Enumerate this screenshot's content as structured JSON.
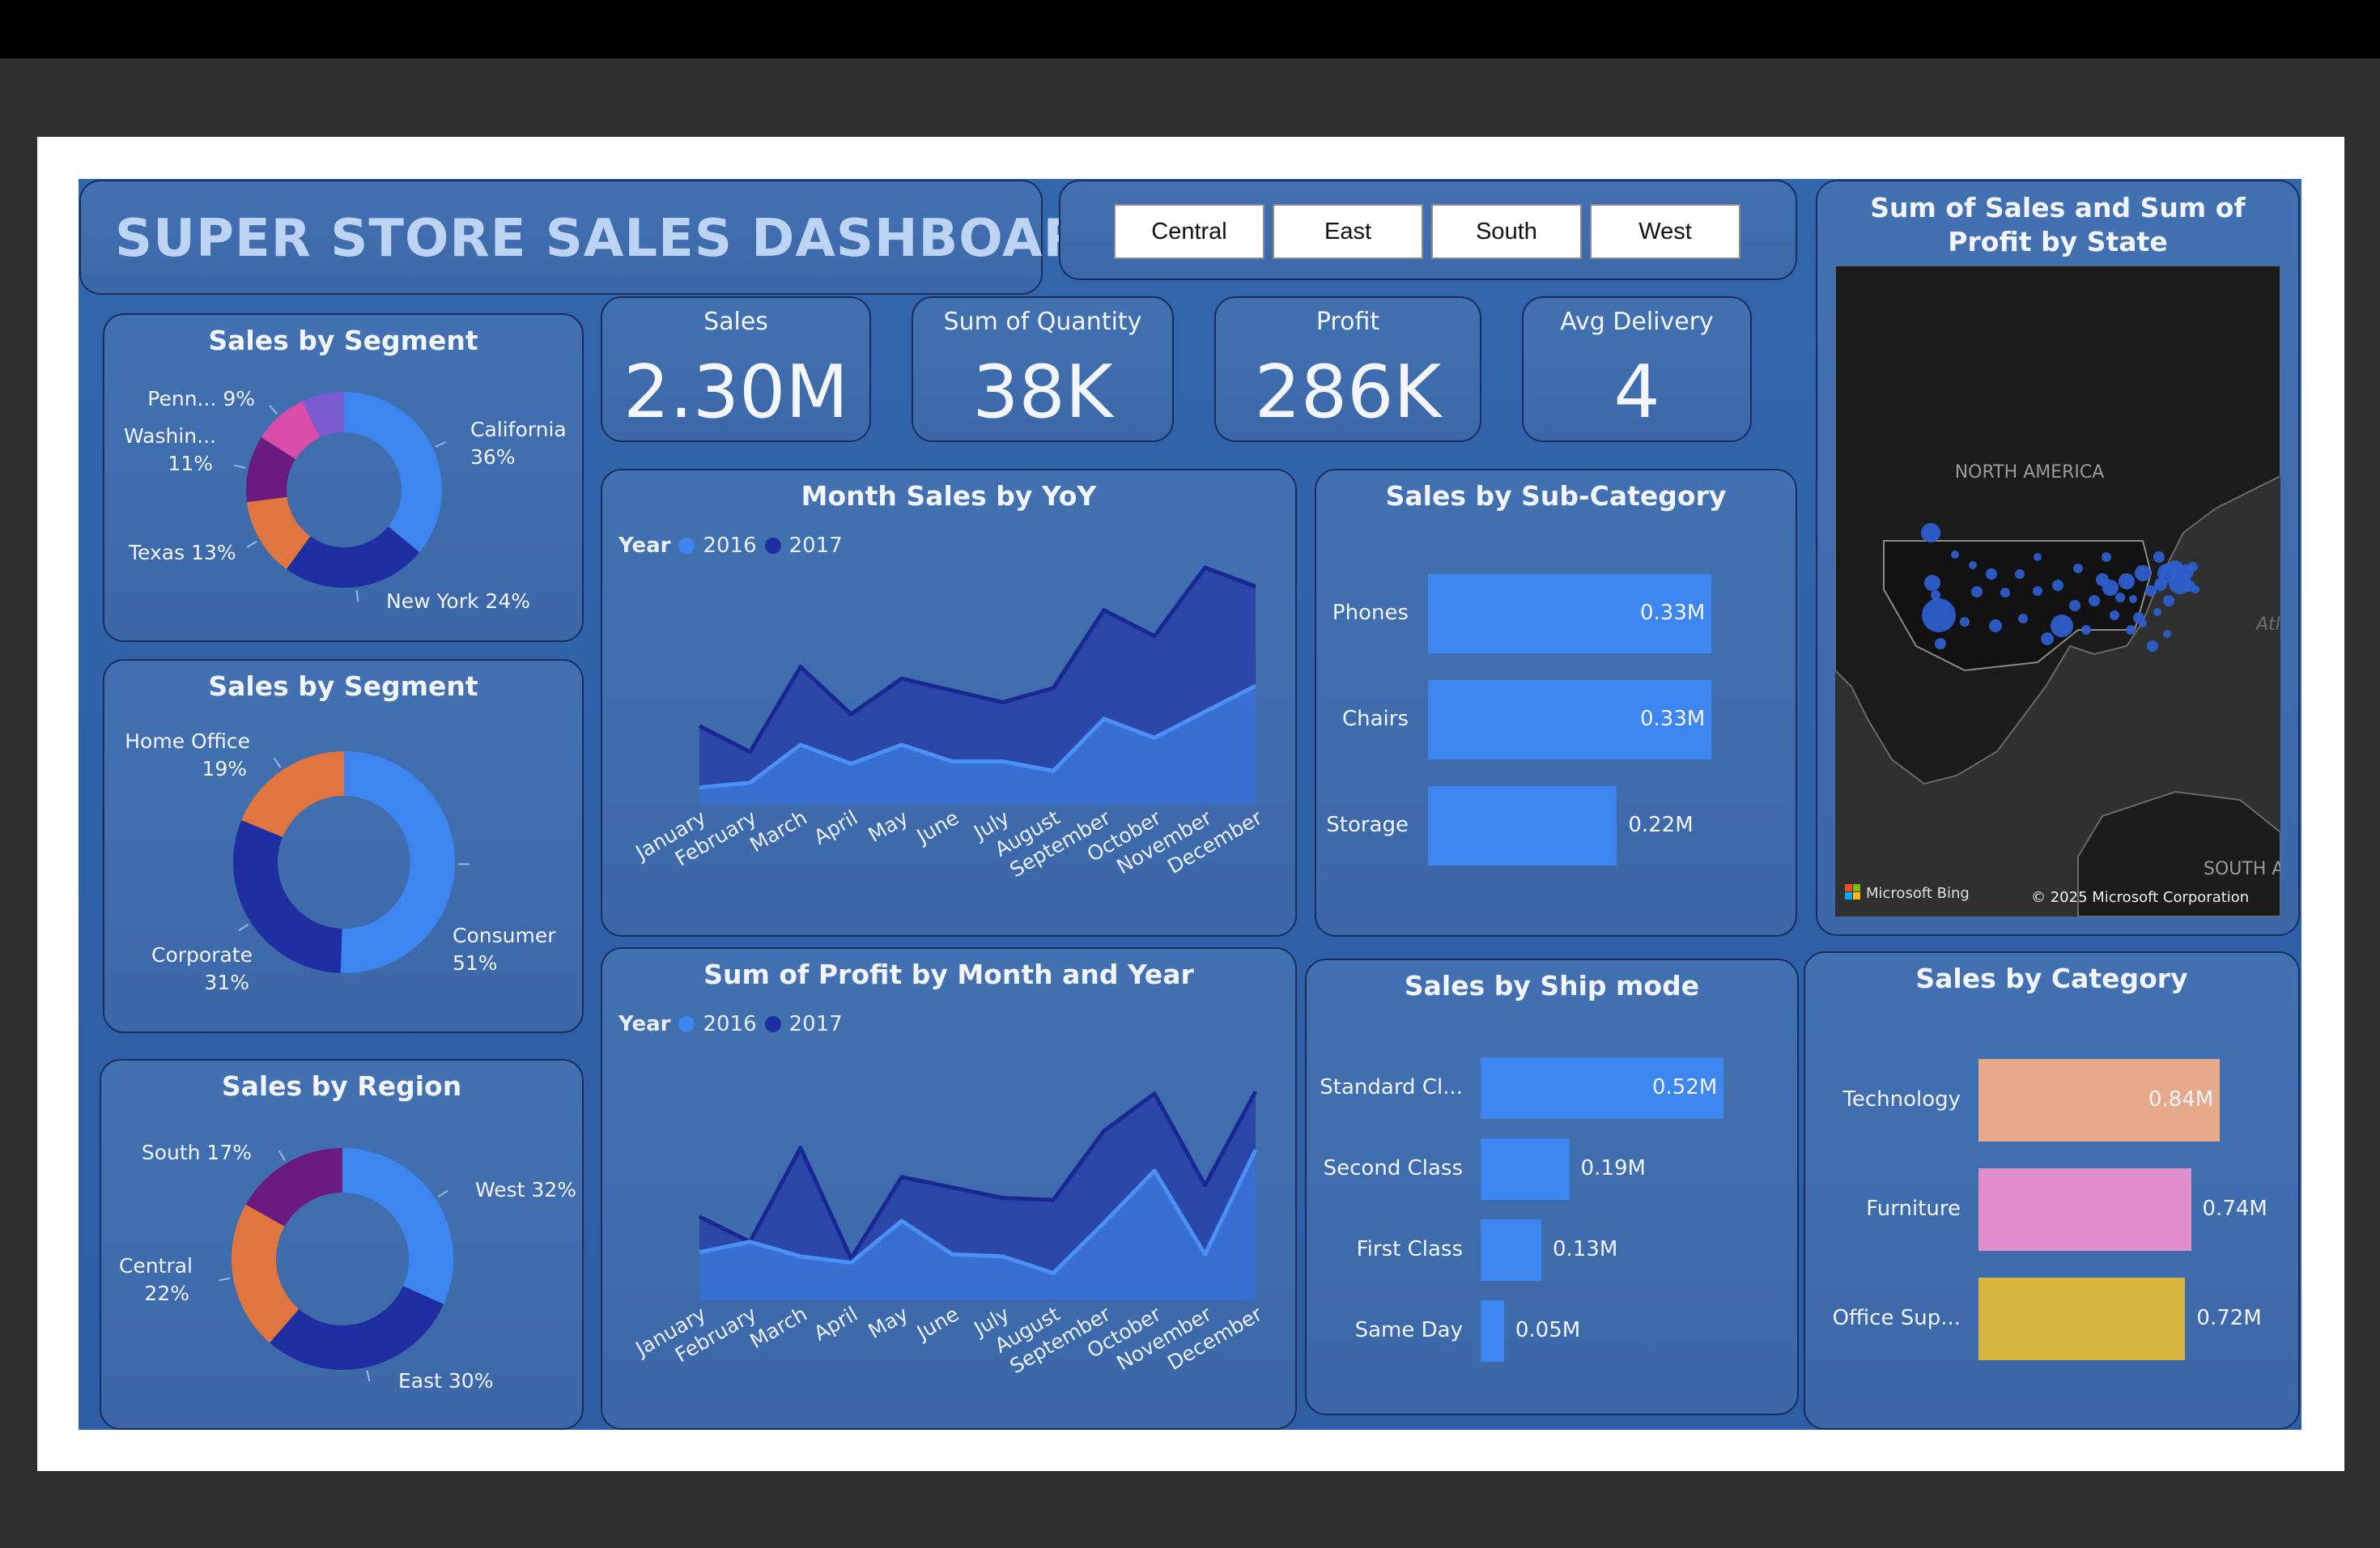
{
  "dashboard": {
    "title": "SUPER STORE SALES DASHBOARD"
  },
  "region_filter": {
    "buttons": [
      "Central",
      "East",
      "South",
      "West"
    ]
  },
  "kpis": [
    {
      "label": "Sales",
      "value": "2.30M"
    },
    {
      "label": "Sum of Quantity",
      "value": "38K"
    },
    {
      "label": "Profit",
      "value": "286K"
    },
    {
      "label": "Avg Delivery",
      "value": "4"
    }
  ],
  "map": {
    "title": "Sum of Sales and Sum of Profit by State",
    "label_continent": "NORTH AMERICA",
    "label_south": "SOUTH A",
    "label_ocean": "Atl",
    "bing": "Microsoft Bing",
    "copyright": "© 2025 Microsoft Corporation"
  },
  "colors": {
    "accent_2016": "#3d86f0",
    "accent_2017": "#1f2ea0",
    "orange": "#e07540",
    "purple": "#6b1a7f",
    "pink": "#d84ea8",
    "violet": "#7b5bd0",
    "technology": "#e6a98a",
    "furniture": "#e28ecb",
    "office": "#d6b43e"
  },
  "chart_data": [
    {
      "type": "pie",
      "title": "Sales by Segment",
      "variant": "donut",
      "slices": [
        {
          "label": "California",
          "pct_label": "36%",
          "value": 36,
          "color": "#3d86f0"
        },
        {
          "label": "New York",
          "pct_label": "24%",
          "value": 24,
          "color": "#1f2ea0"
        },
        {
          "label": "Texas",
          "pct_label": "13%",
          "value": 13,
          "color": "#e07540"
        },
        {
          "label": "Washin...",
          "pct_label": "11%",
          "value": 11,
          "color": "#6b1a7f"
        },
        {
          "label": "Penn...",
          "pct_label": "9%",
          "value": 9,
          "color": "#d84ea8"
        },
        {
          "label": "",
          "pct_label": "",
          "value": 7,
          "color": "#7b5bd0"
        }
      ]
    },
    {
      "type": "pie",
      "title": "Sales by Segment",
      "variant": "donut",
      "slices": [
        {
          "label": "Consumer",
          "pct_label": "51%",
          "value": 51,
          "color": "#3d86f0"
        },
        {
          "label": "Corporate",
          "pct_label": "31%",
          "value": 31,
          "color": "#1f2ea0"
        },
        {
          "label": "Home Office",
          "pct_label": "19%",
          "value": 19,
          "color": "#e07540"
        }
      ]
    },
    {
      "type": "pie",
      "title": "Sales by Region",
      "variant": "donut",
      "slices": [
        {
          "label": "West",
          "pct_label": "32%",
          "value": 32,
          "color": "#3d86f0"
        },
        {
          "label": "East",
          "pct_label": "30%",
          "value": 30,
          "color": "#1f2ea0"
        },
        {
          "label": "Central",
          "pct_label": "22%",
          "value": 22,
          "color": "#e07540"
        },
        {
          "label": "South",
          "pct_label": "17%",
          "value": 17,
          "color": "#6b1a7f"
        }
      ]
    },
    {
      "type": "area",
      "title": "Month Sales by YoY",
      "legend_title": "Year",
      "categories": [
        "January",
        "February",
        "March",
        "April",
        "May",
        "June",
        "July",
        "August",
        "September",
        "October",
        "November",
        "December"
      ],
      "ylim": [
        0,
        1
      ],
      "series": [
        {
          "name": "2016",
          "values": [
            0.07,
            0.09,
            0.25,
            0.17,
            0.25,
            0.18,
            0.18,
            0.14,
            0.36,
            0.28,
            0.39,
            0.5
          ]
        },
        {
          "name": "2017",
          "values": [
            0.33,
            0.22,
            0.58,
            0.38,
            0.53,
            0.48,
            0.43,
            0.49,
            0.82,
            0.71,
            1.0,
            0.92
          ]
        }
      ]
    },
    {
      "type": "area",
      "title": "Sum of Profit by Month and Year",
      "legend_title": "Year",
      "categories": [
        "January",
        "February",
        "March",
        "April",
        "May",
        "June",
        "July",
        "August",
        "September",
        "October",
        "November",
        "December"
      ],
      "ylim": [
        0,
        1
      ],
      "series": [
        {
          "name": "2016",
          "values": [
            0.23,
            0.28,
            0.21,
            0.18,
            0.38,
            0.22,
            0.21,
            0.13,
            0.37,
            0.62,
            0.22,
            0.72
          ]
        },
        {
          "name": "2017",
          "values": [
            0.4,
            0.28,
            0.73,
            0.2,
            0.59,
            0.54,
            0.49,
            0.48,
            0.81,
            0.99,
            0.55,
            1.0
          ]
        }
      ]
    },
    {
      "type": "bar",
      "orientation": "horizontal",
      "title": "Sales by Sub-Category",
      "categories": [
        "Phones",
        "Chairs",
        "Storage"
      ],
      "values": [
        0.33,
        0.33,
        0.22
      ],
      "value_labels": [
        "0.33M",
        "0.33M",
        "0.22M"
      ],
      "color": "#3d86f0"
    },
    {
      "type": "bar",
      "orientation": "horizontal",
      "title": "Sales by Ship mode",
      "categories": [
        "Standard Cl...",
        "Second Class",
        "First Class",
        "Same Day"
      ],
      "values": [
        0.52,
        0.19,
        0.13,
        0.05
      ],
      "value_labels": [
        "0.52M",
        "0.19M",
        "0.13M",
        "0.05M"
      ],
      "color": "#3d86f0"
    },
    {
      "type": "bar",
      "orientation": "horizontal",
      "title": "Sales by Category",
      "categories": [
        "Technology",
        "Furniture",
        "Office Sup..."
      ],
      "values": [
        0.84,
        0.74,
        0.72
      ],
      "value_labels": [
        "0.84M",
        "0.74M",
        "0.72M"
      ],
      "colors": [
        "#e6a98a",
        "#e28ecb",
        "#d6b43e"
      ]
    }
  ]
}
